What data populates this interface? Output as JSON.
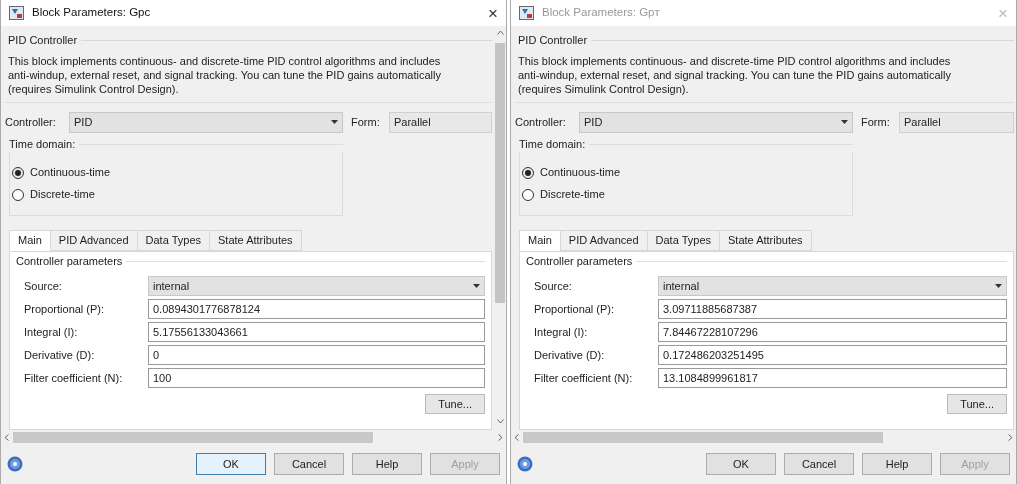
{
  "dialogs": [
    {
      "title": "Block Parameters: Gpc",
      "active": true,
      "close": "×",
      "group_title": "PID Controller",
      "description": [
        "This block implements continuous- and discrete-time PID control algorithms and includes",
        "anti-windup, external reset, and signal tracking. You can tune the PID gains automatically",
        "(requires Simulink Control Design)."
      ],
      "controller": {
        "label": "Controller:",
        "value": "PID"
      },
      "form": {
        "label": "Form:",
        "value": "Parallel"
      },
      "time_domain": {
        "title": "Time domain:",
        "options": [
          {
            "label": "Continuous-time",
            "selected": true
          },
          {
            "label": "Discrete-time",
            "selected": false
          }
        ]
      },
      "tabs": [
        {
          "label": "Main",
          "selected": true
        },
        {
          "label": "PID Advanced",
          "selected": false
        },
        {
          "label": "Data Types",
          "selected": false
        },
        {
          "label": "State Attributes",
          "selected": false
        }
      ],
      "params_title": "Controller parameters",
      "source": {
        "label": "Source:",
        "value": "internal"
      },
      "fields": [
        {
          "label": "Proportional (P):",
          "value": "0.0894301776878124"
        },
        {
          "label": "Integral (I):",
          "value": "5.17556133043661"
        },
        {
          "label": "Derivative (D):",
          "value": "0"
        },
        {
          "label": "Filter coefficient (N):",
          "value": "100"
        }
      ],
      "tune": "Tune...",
      "vertical_scrollbar": true,
      "buttons": [
        {
          "label": "OK",
          "disabled": false,
          "default": true
        },
        {
          "label": "Cancel",
          "disabled": false,
          "default": false
        },
        {
          "label": "Help",
          "disabled": false,
          "default": false
        },
        {
          "label": "Apply",
          "disabled": true,
          "default": false
        }
      ]
    },
    {
      "title": "Block Parameters: Gpт",
      "active": false,
      "close": "×",
      "group_title": "PID Controller",
      "description": [
        "This block implements continuous- and discrete-time PID control algorithms and includes",
        "anti-windup, external reset, and signal tracking. You can tune the PID gains automatically",
        "(requires Simulink Control Design)."
      ],
      "controller": {
        "label": "Controller:",
        "value": "PID"
      },
      "form": {
        "label": "Form:",
        "value": "Parallel"
      },
      "time_domain": {
        "title": "Time domain:",
        "options": [
          {
            "label": "Continuous-time",
            "selected": true
          },
          {
            "label": "Discrete-time",
            "selected": false
          }
        ]
      },
      "tabs": [
        {
          "label": "Main",
          "selected": true
        },
        {
          "label": "PID Advanced",
          "selected": false
        },
        {
          "label": "Data Types",
          "selected": false
        },
        {
          "label": "State Attributes",
          "selected": false
        }
      ],
      "params_title": "Controller parameters",
      "source": {
        "label": "Source:",
        "value": "internal"
      },
      "fields": [
        {
          "label": "Proportional (P):",
          "value": "3.09711885687387"
        },
        {
          "label": "Integral (I):",
          "value": "7.84467228107296"
        },
        {
          "label": "Derivative (D):",
          "value": "0.172486203251495"
        },
        {
          "label": "Filter coefficient (N):",
          "value": "13.1084899961817"
        }
      ],
      "tune": "Tune...",
      "vertical_scrollbar": false,
      "buttons": [
        {
          "label": "OK",
          "disabled": false,
          "default": false
        },
        {
          "label": "Cancel",
          "disabled": false,
          "default": false
        },
        {
          "label": "Help",
          "disabled": false,
          "default": false
        },
        {
          "label": "Apply",
          "disabled": true,
          "default": false
        }
      ]
    }
  ]
}
